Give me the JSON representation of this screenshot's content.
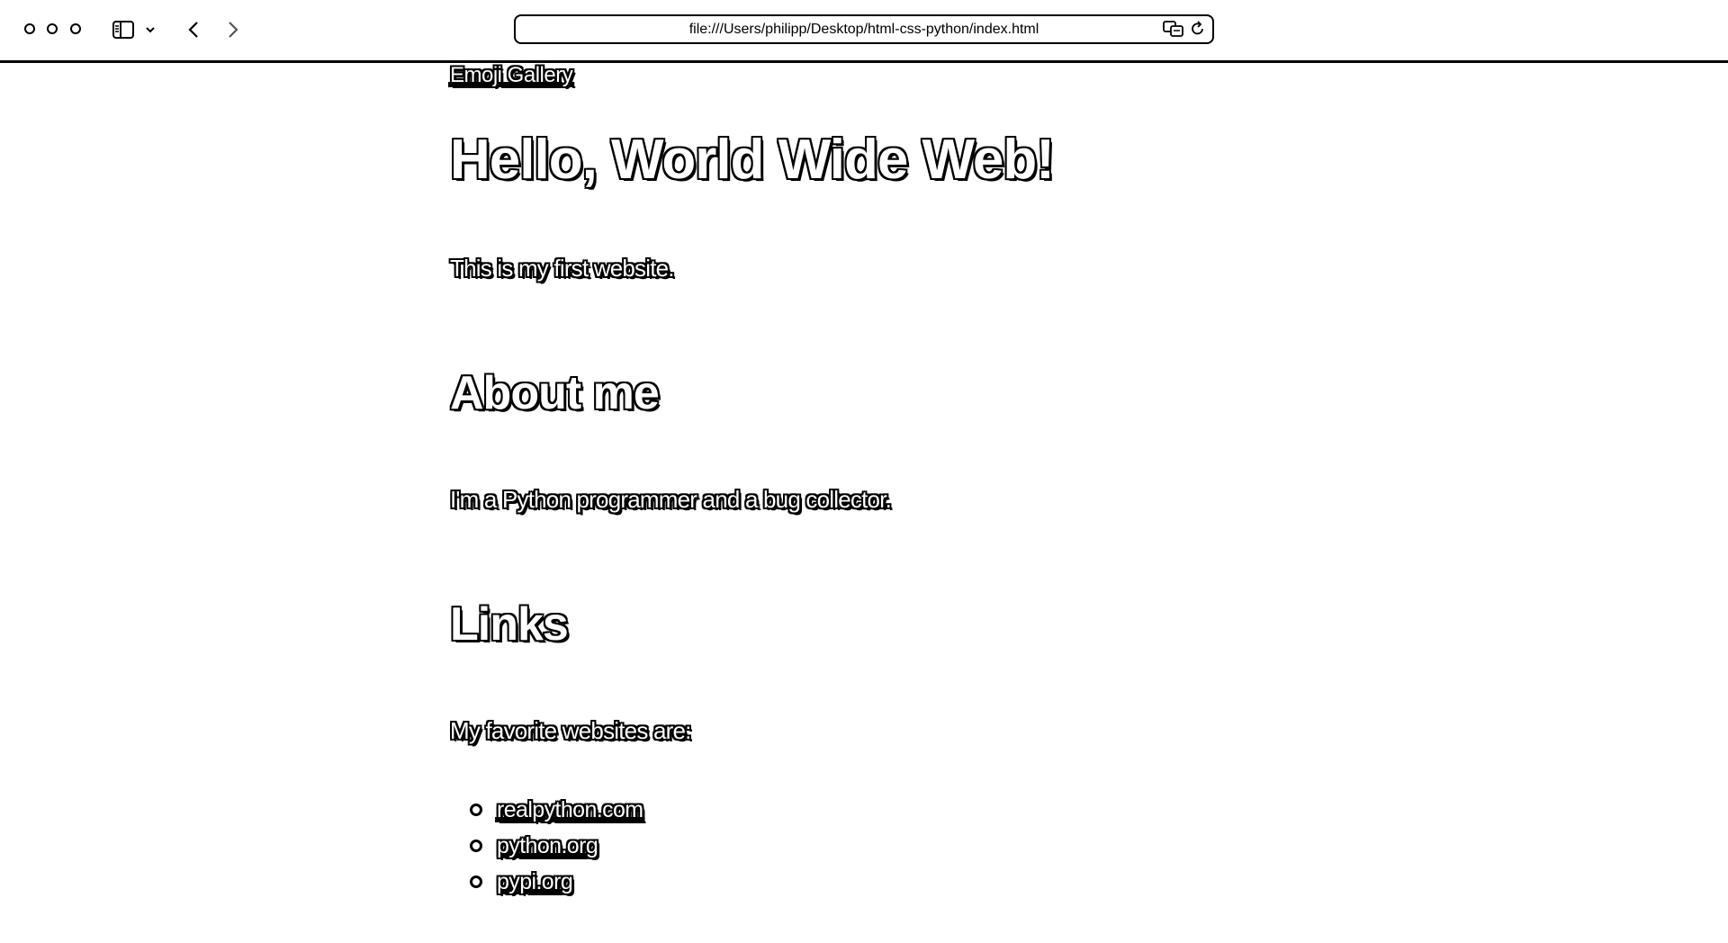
{
  "browser": {
    "address": "file:///Users/philipp/Desktop/html-css-python/index.html"
  },
  "page": {
    "nav_link": "Emoji Gallery",
    "title": "Hello, World Wide Web!",
    "intro": "This is my first website.",
    "about_heading": "About me",
    "about_text": "I'm a Python programmer and a bug collector.",
    "links_heading": "Links",
    "links_text": "My favorite websites are:",
    "favorites": [
      "realpython.com",
      "python.org",
      "pypi.org"
    ]
  }
}
